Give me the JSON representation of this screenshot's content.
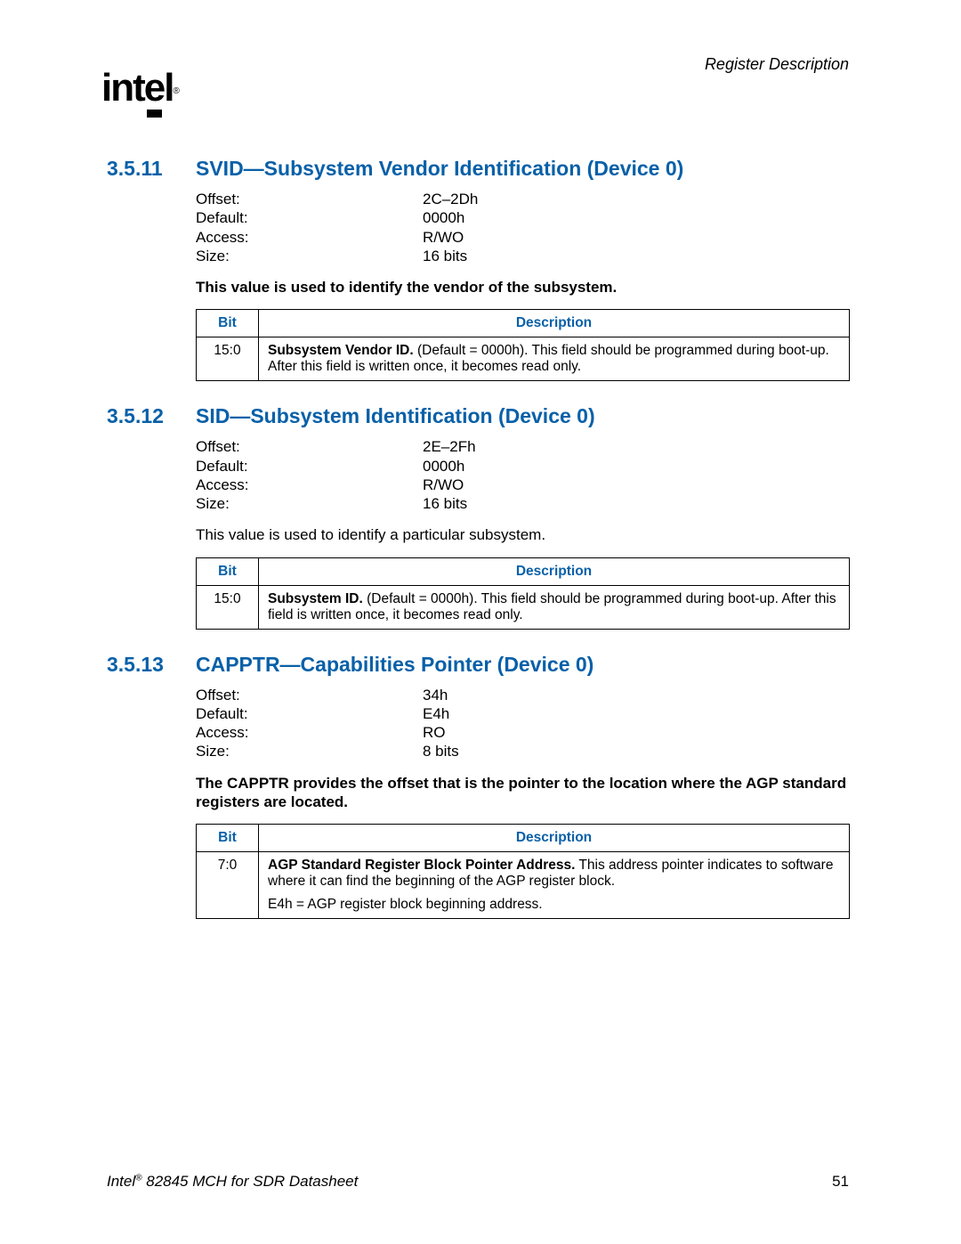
{
  "header": {
    "right": "Register Description"
  },
  "logo": {
    "text": "intel",
    "reg": "®"
  },
  "footer": {
    "doc_prefix": "Intel",
    "doc_reg": "®",
    "doc_suffix": " 82845 MCH for SDR Datasheet",
    "page": "51"
  },
  "table_headers": {
    "bit": "Bit",
    "desc": "Description"
  },
  "meta_labels": {
    "offset": "Offset:",
    "default": "Default:",
    "access": "Access:",
    "size": "Size:"
  },
  "sections": [
    {
      "num": "3.5.11",
      "title": "SVID—Subsystem Vendor Identification (Device 0)",
      "meta": {
        "offset": "2C–2Dh",
        "default": "0000h",
        "access": "R/WO",
        "size": "16 bits"
      },
      "intro_bold": true,
      "intro": "This value is used to identify the vendor of the subsystem.",
      "rows": [
        {
          "bit": "15:0",
          "field": "Subsystem Vendor ID.",
          "desc": " (Default = 0000h). This field should be programmed during boot-up. After this field is written once, it becomes read only."
        }
      ]
    },
    {
      "num": "3.5.12",
      "title": "SID—Subsystem Identification (Device 0)",
      "meta": {
        "offset": "2E–2Fh",
        "default": "0000h",
        "access": "R/WO",
        "size": "16 bits"
      },
      "intro_bold": false,
      "intro": "This value is used to identify a particular subsystem.",
      "rows": [
        {
          "bit": "15:0",
          "field": "Subsystem ID.",
          "desc": " (Default = 0000h). This field should be programmed during boot-up. After this field is written once, it becomes read only."
        }
      ]
    },
    {
      "num": "3.5.13",
      "title": "CAPPTR—Capabilities Pointer (Device 0)",
      "meta": {
        "offset": "34h",
        "default": "E4h",
        "access": "RO",
        "size": "8 bits"
      },
      "intro_bold": true,
      "intro": "The CAPPTR provides the offset that is the pointer to the location where the AGP standard registers are located.",
      "rows": [
        {
          "bit": "7:0",
          "field": "AGP Standard Register Block Pointer Address.",
          "desc": " This address pointer indicates to software where it can find the beginning of the AGP register block.",
          "extra": "E4h = AGP register block beginning address."
        }
      ]
    }
  ]
}
